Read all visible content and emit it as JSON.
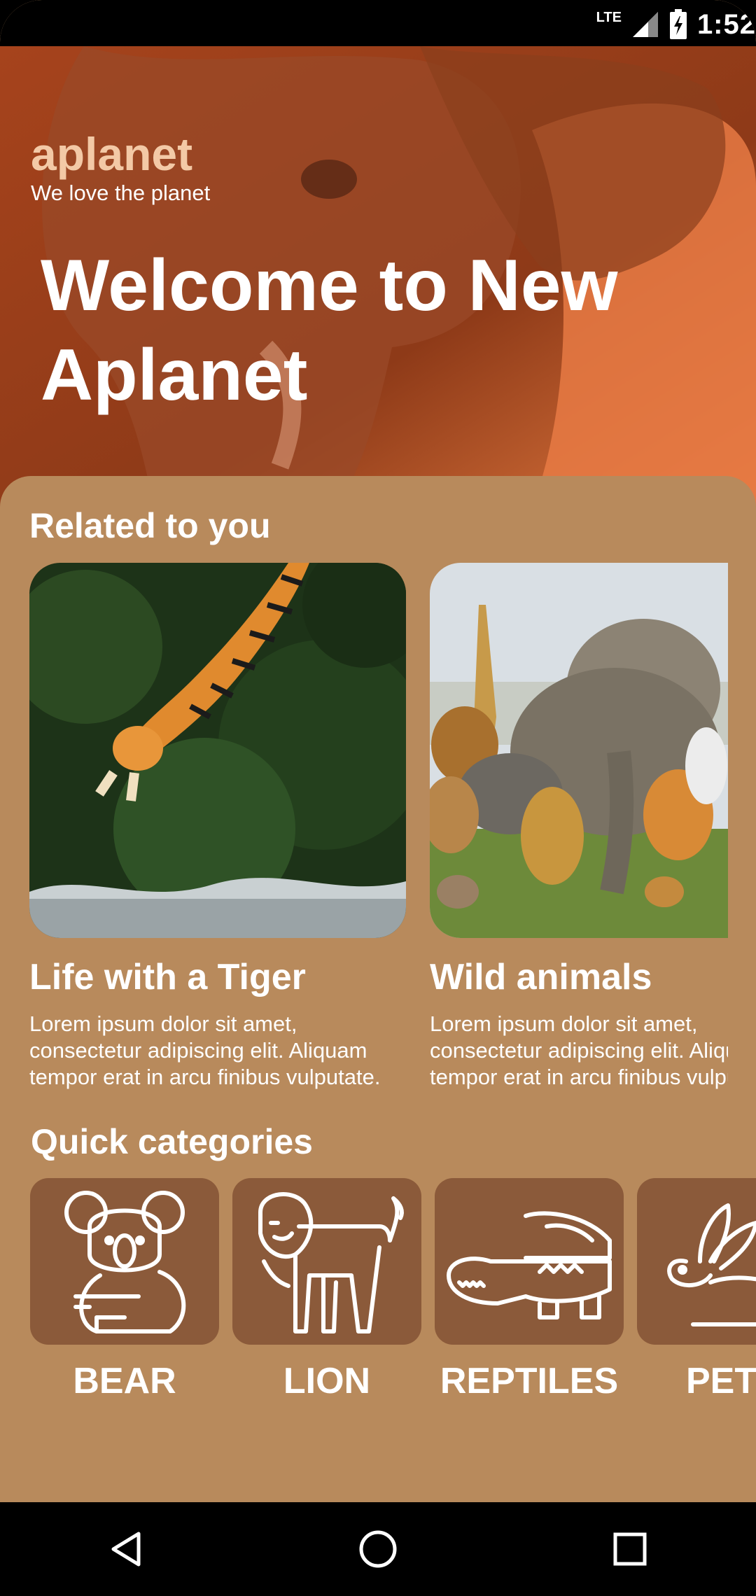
{
  "status": {
    "network": "LTE",
    "time": "1:52"
  },
  "app": {
    "brand": "aplanet",
    "tagline": "We love the planet",
    "hero_title": "Welcome to New Aplanet"
  },
  "related": {
    "title": "Related to you",
    "cards": [
      {
        "title": "Life with a Tiger",
        "text": "Lorem ipsum dolor sit amet,\nconsectetur adipiscing elit. Aliquam\ntempor erat in arcu finibus vulputate.",
        "image": "tiger-photo"
      },
      {
        "title": "Wild animals",
        "text": "Lorem ipsum dolor sit amet,\nconsectetur adipiscing elit. Aliquam\ntempor erat in arcu finibus vulputate.",
        "image": "wild-animals-photo"
      }
    ]
  },
  "categories": {
    "title": "Quick categories",
    "items": [
      {
        "label": "BEAR",
        "icon": "koala-icon"
      },
      {
        "label": "LION",
        "icon": "lion-icon"
      },
      {
        "label": "REPTILES",
        "icon": "crocodile-icon"
      },
      {
        "label": "PETS",
        "icon": "rabbit-icon"
      }
    ]
  },
  "nav": {
    "back": "back-icon",
    "home": "home-icon",
    "recents": "recents-icon"
  },
  "colors": {
    "sheet": "#b88a5c",
    "tile": "#8b5a3a",
    "hero": "#a84b24"
  }
}
